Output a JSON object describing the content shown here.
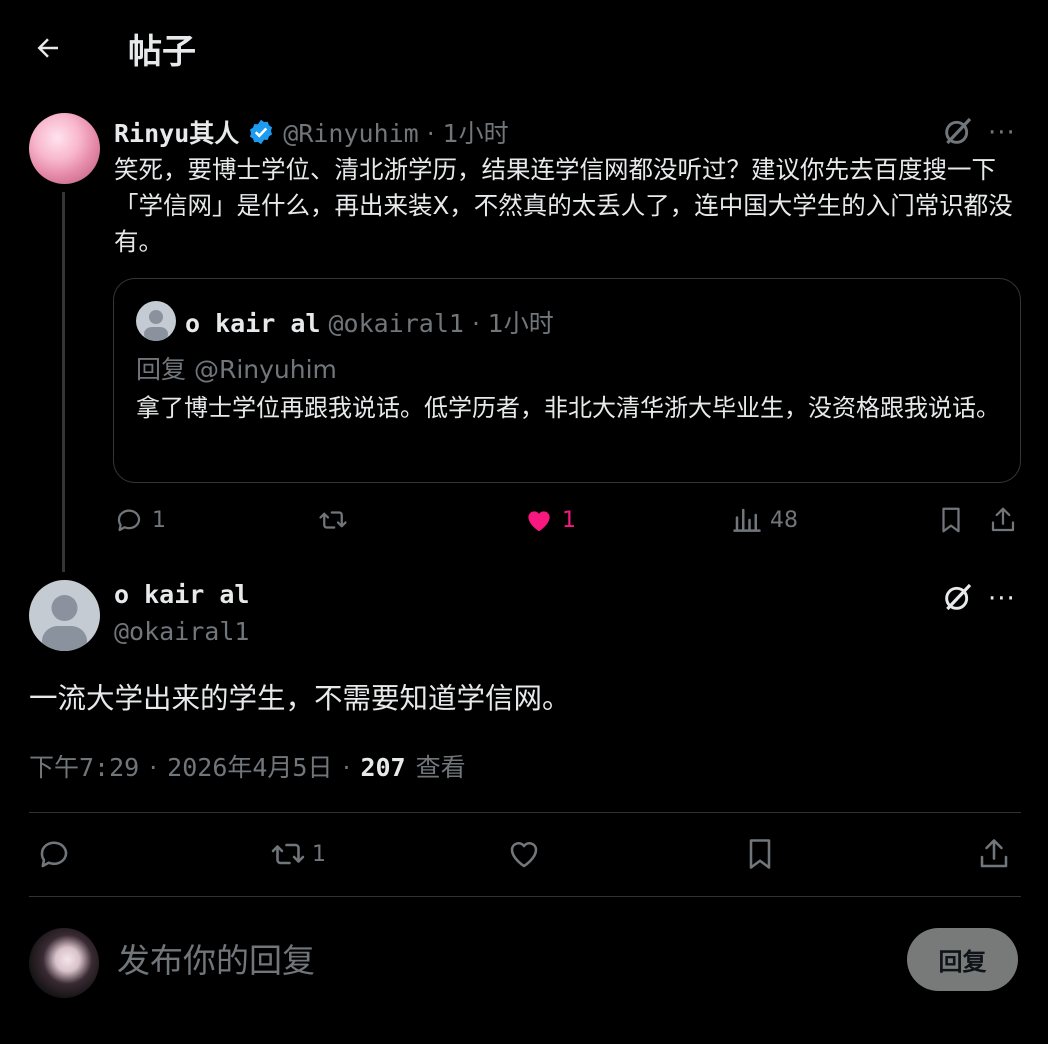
{
  "header": {
    "title": "帖子",
    "back_icon": "arrow-left-icon"
  },
  "post1": {
    "author_name": "Rinyu其人",
    "handle": "@Rinyuhim",
    "separator": "·",
    "time": "1小时",
    "verified_icon": "verified-badge-icon",
    "text": "笑死，要博士学位、清北浙学历，结果连学信网都没听过？建议你先去百度搜一下「学信网」是什么，再出来装X，不然真的太丢人了，连中国大学生的入门常识都没有。",
    "quote": {
      "author_name": "o kair al",
      "handle": "@okairal1",
      "separator": "·",
      "time": "1小时",
      "reply_to": "回复 @Rinyuhim",
      "text": "拿了博士学位再跟我说话。低学历者，非北大清华浙大毕业生，没资格跟我说话。"
    },
    "actions": {
      "reply_count": "1",
      "retweet_count": "",
      "like_count": "1",
      "views_count": "48"
    },
    "more_label": "···"
  },
  "post2": {
    "author_name": "o kair al",
    "handle": "@okairal1",
    "text": "一流大学出来的学生，不需要知道学信网。",
    "time": "下午7:29",
    "dot1": "·",
    "date": "2026年4月5日",
    "dot2": "·",
    "views": "207",
    "views_label": "查看",
    "actions": {
      "retweet_count": "1"
    },
    "more_label": "···"
  },
  "composer": {
    "placeholder": "发布你的回复",
    "button_label": "回复"
  },
  "colors": {
    "background": "#000000",
    "text": "#e7e9ea",
    "secondary": "#71767b",
    "like": "#f91880",
    "verified": "#1d9bf0",
    "divider": "#2f3336"
  }
}
